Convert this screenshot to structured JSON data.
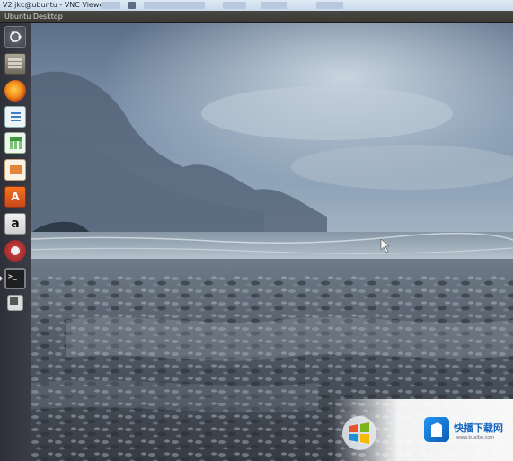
{
  "vnc_window": {
    "title": "V2 jkc@ubuntu - VNC Viewer"
  },
  "top_panel": {
    "title": "Ubuntu Desktop"
  },
  "launcher": {
    "items": [
      {
        "name": "dash-home",
        "icon": "ubuntu-logo-icon"
      },
      {
        "name": "files",
        "icon": "file-cabinet-icon"
      },
      {
        "name": "firefox",
        "icon": "firefox-icon"
      },
      {
        "name": "libreoffice-writer",
        "icon": "writer-document-icon"
      },
      {
        "name": "libreoffice-calc",
        "icon": "spreadsheet-icon"
      },
      {
        "name": "libreoffice-impress",
        "icon": "presentation-icon"
      },
      {
        "name": "ubuntu-software-center",
        "icon": "shopping-bag-icon",
        "glyph": "A"
      },
      {
        "name": "amazon",
        "icon": "amazon-icon",
        "glyph": "a"
      },
      {
        "name": "system-settings",
        "icon": "settings-gear-icon"
      },
      {
        "name": "terminal",
        "icon": "terminal-icon",
        "glyph": ">_"
      },
      {
        "name": "workspace-switcher",
        "icon": "workspace-switcher-icon"
      }
    ]
  },
  "watermark": {
    "title": "快播下载网",
    "subtitle": "www.kuaibo.com"
  },
  "colors": {
    "panel": "#3a3833",
    "launcher": "#2d3038",
    "accent": "#1565c0"
  }
}
